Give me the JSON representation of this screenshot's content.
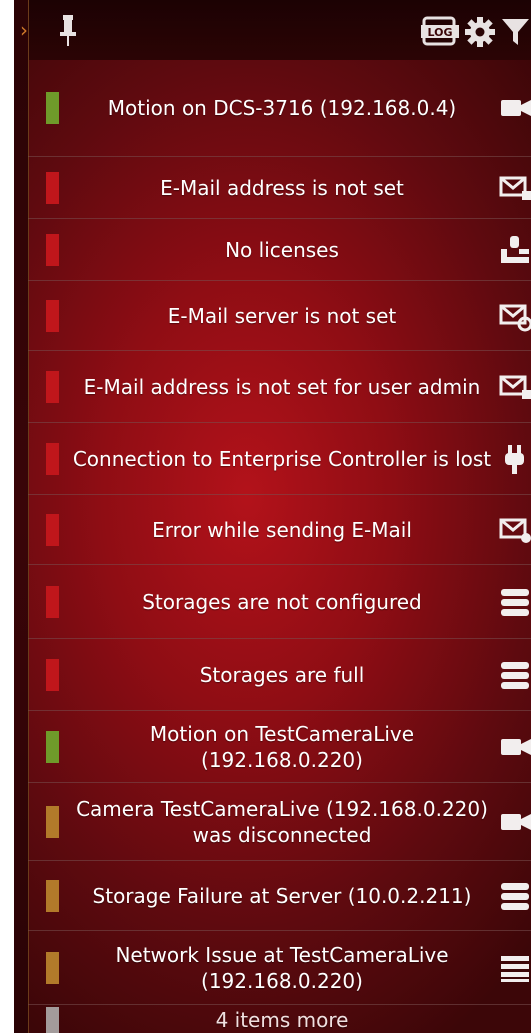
{
  "toolbar": {
    "log_label": "LOG",
    "collapse_glyph": "›",
    "icons": [
      "pin-icon",
      "log-icon",
      "gear-icon",
      "filter-icon"
    ]
  },
  "colors": {
    "green": "#6f9a2a",
    "red": "#c0161b",
    "amber": "#b27a2a",
    "gray": "#a39b9b"
  },
  "notifications": [
    {
      "text": "Motion on DCS-3716 (192.168.0.4)",
      "level": "green",
      "icon": "camera-icon"
    },
    {
      "text": "E-Mail address is not set",
      "level": "red",
      "icon": "mail-icon"
    },
    {
      "text": "No licenses",
      "level": "red",
      "icon": "license-icon"
    },
    {
      "text": "E-Mail server is not set",
      "level": "red",
      "icon": "mail-settings-icon"
    },
    {
      "text": "E-Mail address is not set for user admin",
      "level": "red",
      "icon": "mail-icon"
    },
    {
      "text": "Connection to Enterprise Controller is lost",
      "level": "red",
      "icon": "plug-icon"
    },
    {
      "text": "Error while sending E-Mail",
      "level": "red",
      "icon": "mail-error-icon"
    },
    {
      "text": "Storages are not configured",
      "level": "red",
      "icon": "storage-icon"
    },
    {
      "text": "Storages are full",
      "level": "red",
      "icon": "storage-icon"
    },
    {
      "text": "Motion on TestCameraLive (192.168.0.220)",
      "level": "green",
      "icon": "camera-icon"
    },
    {
      "text": "Camera TestCameraLive (192.168.0.220) was disconnected",
      "level": "amber",
      "icon": "camera-icon"
    },
    {
      "text": "Storage Failure at Server (10.0.2.211)",
      "level": "amber",
      "icon": "storage-icon"
    },
    {
      "text": "Network Issue at TestCameraLive (192.168.0.220)",
      "level": "amber",
      "icon": "network-icon"
    }
  ],
  "more": {
    "text": "4 items more",
    "level": "gray"
  }
}
